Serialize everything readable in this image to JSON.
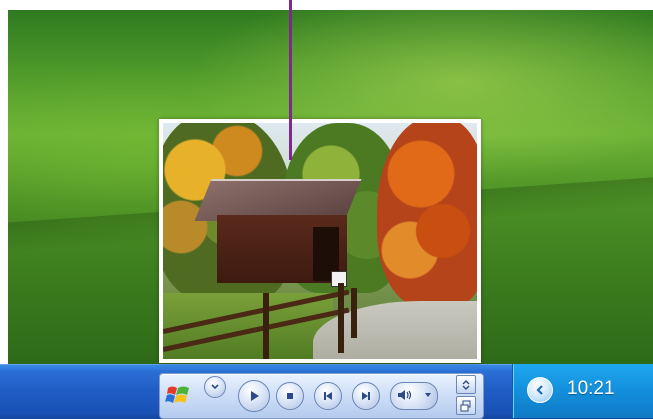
{
  "tray": {
    "clock": "10:21",
    "expand_icon": "chevron-left-icon"
  },
  "player": {
    "controls": [
      "switch-to-full-mode-icon",
      "menu-chevron-icon",
      "play-icon",
      "stop-icon",
      "previous-icon",
      "next-icon",
      "mute-icon",
      "volume-icon",
      "restore-icon"
    ]
  },
  "colors": {
    "taskbar": "#1f5cc4",
    "tray": "#138fdc",
    "callout": "#7d2a8a"
  }
}
